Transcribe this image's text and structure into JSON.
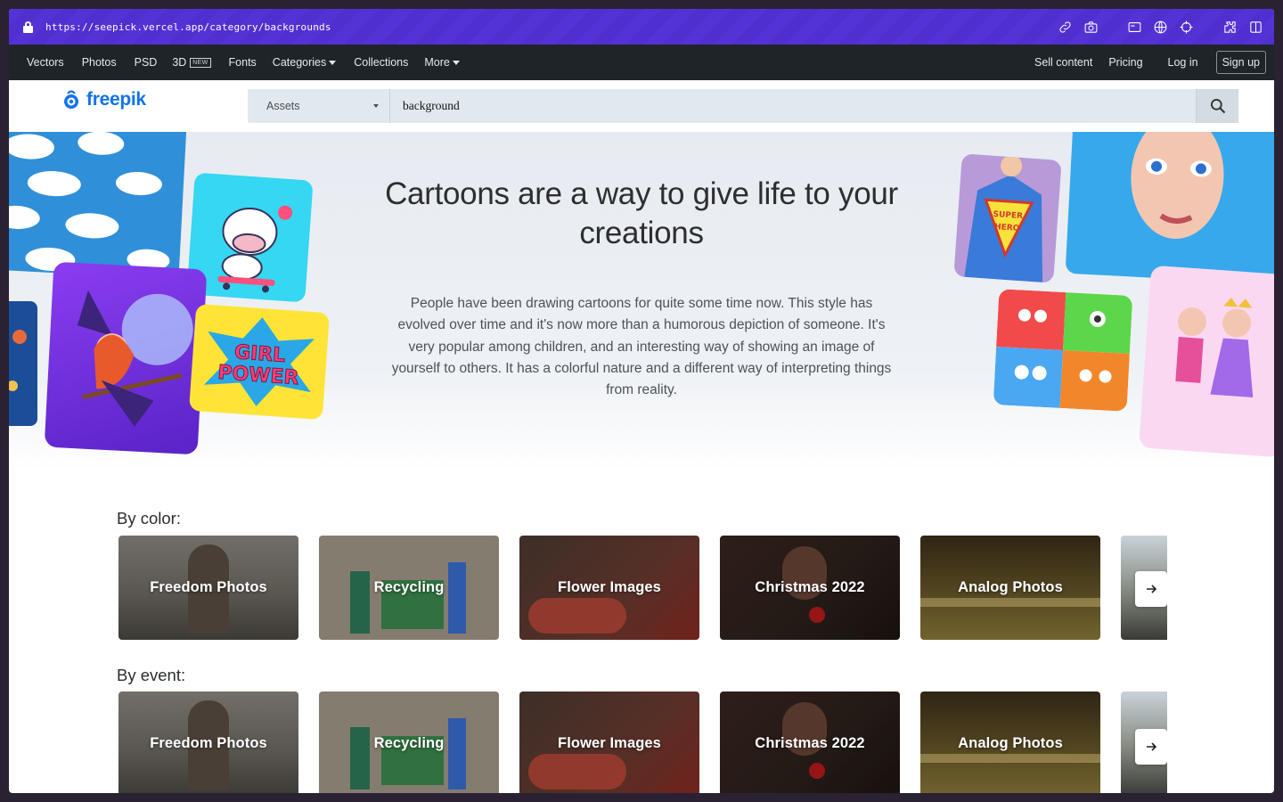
{
  "browser": {
    "url": "https://seepick.vercel.app/category/backgrounds",
    "tools": [
      "link-icon",
      "camera-icon",
      "window-icon",
      "globe-icon",
      "crosshair-icon",
      "extension-icon",
      "sidebar-icon"
    ]
  },
  "topnav": {
    "items": [
      {
        "label": "Vectors"
      },
      {
        "label": "Photos"
      },
      {
        "label": "PSD"
      },
      {
        "label": "3D",
        "badge": "NEW"
      },
      {
        "label": "Fonts"
      },
      {
        "label": "Categories"
      },
      {
        "label": "Collections"
      },
      {
        "label": "More"
      }
    ],
    "sell": "Sell content",
    "pricing": "Pricing",
    "login": "Log in",
    "signup": "Sign up"
  },
  "header": {
    "logo": "freepik",
    "search": {
      "category": "Assets",
      "query": "background"
    }
  },
  "hero": {
    "title": "Cartoons are a way to give life to your creations",
    "text": "People have been drawing cartoons for quite some time now. This style has evolved over time and it's now more than a humorous depiction of someone. It's very popular among children, and an interesting way of showing an image of yourself to others. It has a colorful nature and a different way of interpreting things from reality.",
    "art_text_1": "GIRL",
    "art_text_2": "POWER",
    "art_text_3": "SUPER",
    "art_text_4": "HERO"
  },
  "sections": [
    {
      "label": "By color:",
      "cards": [
        {
          "label": "Freedom Photos",
          "color": "#6e6a63"
        },
        {
          "label": "Recycling",
          "color": "#9a8f81"
        },
        {
          "label": "Flower Images",
          "color": "#5a4438"
        },
        {
          "label": "Christmas 2022",
          "color": "#2e2420"
        },
        {
          "label": "Analog Photos",
          "color": "#5a4a22"
        }
      ]
    },
    {
      "label": "By event:",
      "cards": [
        {
          "label": "Freedom Photos",
          "color": "#6e6a63"
        },
        {
          "label": "Recycling",
          "color": "#9a8f81"
        },
        {
          "label": "Flower Images",
          "color": "#5a4438"
        },
        {
          "label": "Christmas 2022",
          "color": "#2e2420"
        },
        {
          "label": "Analog Photos",
          "color": "#5a4a22"
        }
      ]
    }
  ],
  "colors": {
    "urlbar": "#5433d6",
    "nav": "#1f2428",
    "brand": "#1273eb"
  }
}
